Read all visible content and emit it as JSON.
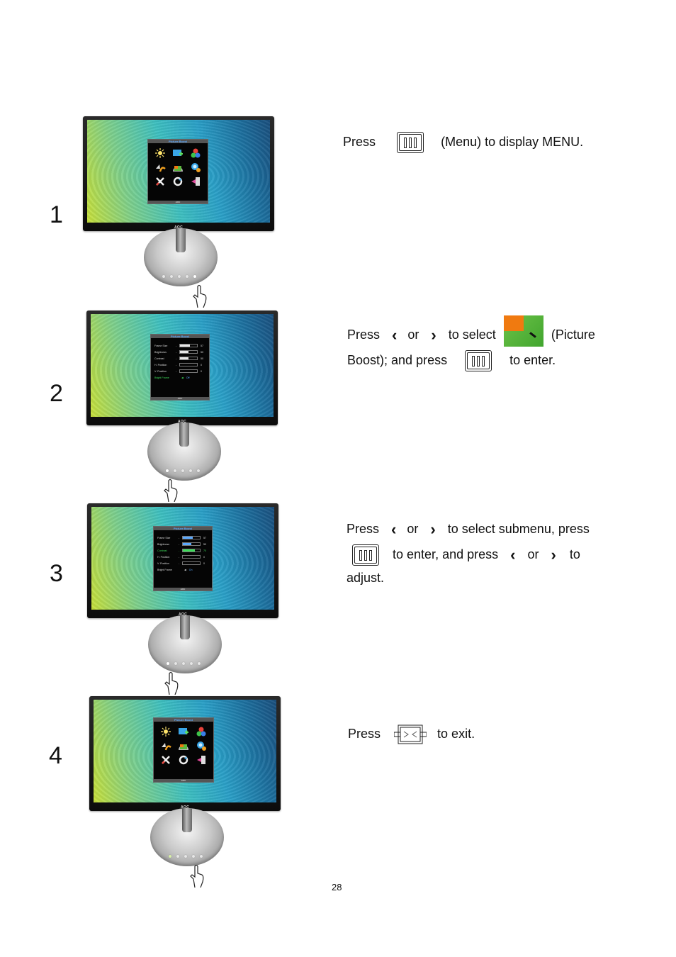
{
  "page": {
    "number": "28"
  },
  "steps": [
    {
      "number": "1",
      "osd": {
        "type": "icon-grid",
        "title": "Picture Boost",
        "footer": "AOC",
        "icons": [
          "brightness-icon",
          "image-setup-icon",
          "color-setup-icon",
          "picture-boost-return-icon",
          "picture-boost-icon",
          "osd-setup-icon",
          "extra-icon",
          "reset-icon",
          "exit-icon"
        ]
      },
      "text": {
        "press": "Press",
        "key": "menu-key-icon",
        "rest": "(Menu) to display MENU."
      }
    },
    {
      "number": "2",
      "osd": {
        "type": "settings-list",
        "title": "Picture Boost",
        "footer": "AOC",
        "rows": [
          {
            "label": "Frame Size",
            "value": "57",
            "fill": 0.57
          },
          {
            "label": "Brightness",
            "value": "50",
            "fill": 0.5
          },
          {
            "label": "Contrast",
            "value": "50",
            "fill": 0.5
          },
          {
            "label": "H. Position",
            "value": "0",
            "fill": 0
          },
          {
            "label": "V. Position",
            "value": "0",
            "fill": 0
          },
          {
            "label": "Bright Frame",
            "value": "Off",
            "fill": null,
            "highlight": true
          }
        ]
      },
      "text": {
        "press": "Press",
        "or": "or",
        "to_select": "to select",
        "picture": "(Picture",
        "boost_and_press": "Boost); and press",
        "to_enter": "to enter."
      }
    },
    {
      "number": "3",
      "osd": {
        "type": "settings-list",
        "title": "Picture Boost",
        "footer": "AOC",
        "rows": [
          {
            "label": "Frame Size",
            "value": "57",
            "fill": 0.57
          },
          {
            "label": "Brightness",
            "value": "50",
            "fill": 0.5
          },
          {
            "label": "Contrast",
            "value": "70",
            "fill": 0.7,
            "highlight": true
          },
          {
            "label": "H. Position",
            "value": "0",
            "fill": 0
          },
          {
            "label": "V. Position",
            "value": "0",
            "fill": 0
          },
          {
            "label": "Bright Frame",
            "value": "On",
            "fill": null
          }
        ]
      },
      "text": {
        "press": "Press",
        "or": "or",
        "to_select_submenu": "to select submenu, press",
        "to_enter_and_press": "to enter, and press",
        "or2": "or",
        "to": "to",
        "adjust": "adjust."
      }
    },
    {
      "number": "4",
      "osd": {
        "type": "icon-grid",
        "title": "Picture Boost",
        "footer": "AOC"
      },
      "text": {
        "press": "Press",
        "to_exit": "to exit."
      }
    }
  ],
  "monitor": {
    "brand": "AOC"
  },
  "colors": {
    "osd_highlight": "#3ddc5a",
    "osd_accent": "#5aa9ff",
    "picture_boost_orange": "#f07a10",
    "picture_boost_green": "#5bb83c"
  }
}
